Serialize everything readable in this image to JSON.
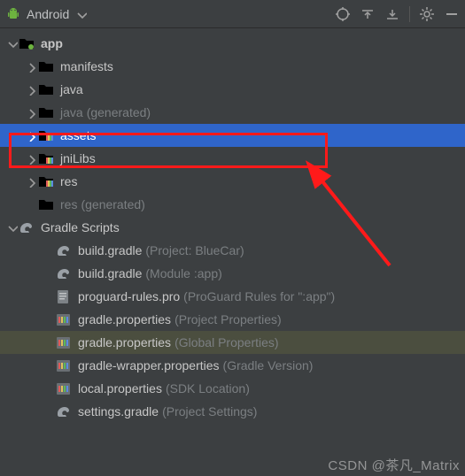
{
  "header": {
    "mode_label": "Android"
  },
  "tree": {
    "app": {
      "label": "app",
      "children": {
        "manifests": {
          "label": "manifests"
        },
        "java": {
          "label": "java"
        },
        "java_gen": {
          "label": "java",
          "hint": "(generated)"
        },
        "assets": {
          "label": "assets"
        },
        "jniLibs": {
          "label": "jniLibs"
        },
        "res": {
          "label": "res"
        },
        "res_gen": {
          "label": "res",
          "hint": "(generated)"
        }
      }
    },
    "gradle_scripts": {
      "label": "Gradle Scripts",
      "children": [
        {
          "name": "build.gradle",
          "hint": "(Project: BlueCar)",
          "icon": "gradle"
        },
        {
          "name": "build.gradle",
          "hint": "(Module :app)",
          "icon": "gradle"
        },
        {
          "name": "proguard-rules.pro",
          "hint": "(ProGuard Rules for \":app\")",
          "icon": "text"
        },
        {
          "name": "gradle.properties",
          "hint": "(Project Properties)",
          "icon": "props"
        },
        {
          "name": "gradle.properties",
          "hint": "(Global Properties)",
          "icon": "props"
        },
        {
          "name": "gradle-wrapper.properties",
          "hint": "(Gradle Version)",
          "icon": "props"
        },
        {
          "name": "local.properties",
          "hint": "(SDK Location)",
          "icon": "props"
        },
        {
          "name": "settings.gradle",
          "hint": "(Project Settings)",
          "icon": "gradle"
        }
      ]
    }
  },
  "watermark": "CSDN @茶凡_Matrix"
}
